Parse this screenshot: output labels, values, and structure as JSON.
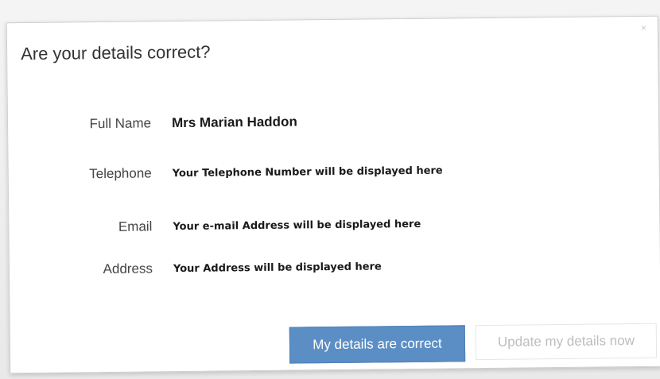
{
  "dialog": {
    "title": "Are your details correct?",
    "close_label": "×",
    "fields": [
      {
        "label": "Full Name",
        "value": "Mrs Marian Haddon"
      },
      {
        "label": "Telephone",
        "value": "Your Telephone Number will be displayed here"
      },
      {
        "label": "Email",
        "value": "Your e-mail Address will be displayed here"
      },
      {
        "label": "Address",
        "value": "Your Address will be displayed here"
      }
    ],
    "buttons": {
      "confirm_label": "My details are correct",
      "update_label": "Update my details now"
    }
  },
  "colors": {
    "primary_button": "#5b8ec4",
    "secondary_text": "#bdbdbd"
  },
  "icons": {
    "close": "close-icon"
  }
}
